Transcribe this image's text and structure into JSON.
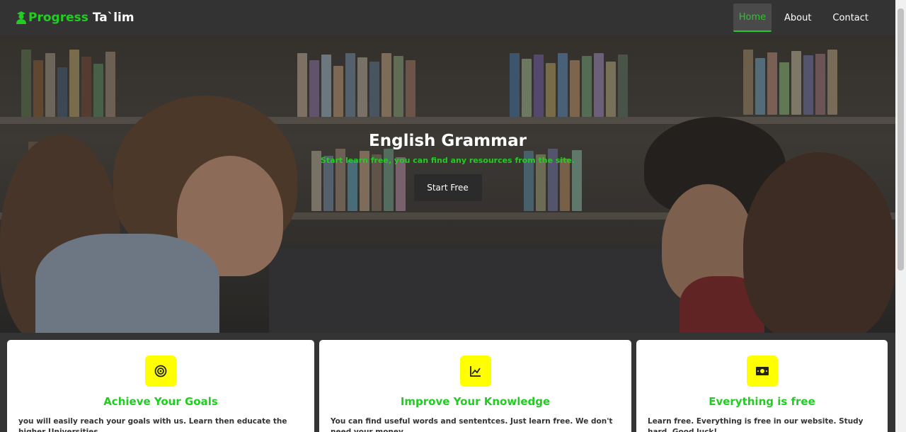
{
  "brand": {
    "name_a": "Progress",
    "name_b": "Ta`lim"
  },
  "nav": {
    "home": "Home",
    "about": "About",
    "contact": "Contact"
  },
  "hero": {
    "title": "English Grammar",
    "subtitle": "Start learn free, you can find any resources from the site.",
    "button": "Start Free"
  },
  "cards": [
    {
      "icon": "target-icon",
      "title": "Achieve Your Goals",
      "text": "you will easily reach your goals with us. Learn then educate the higher Universities"
    },
    {
      "icon": "chart-line-icon",
      "title": "Improve Your Knowledge",
      "text": "You can find useful words and sententces. Just learn free. We don't need your money"
    },
    {
      "icon": "money-icon",
      "title": "Everything is free",
      "text": "Learn free. Everything is free in our website. Study hard. Good luck!"
    }
  ],
  "colors": {
    "accent": "#22cc22",
    "icon_bg": "#ffff00",
    "navbar": "#333333"
  }
}
